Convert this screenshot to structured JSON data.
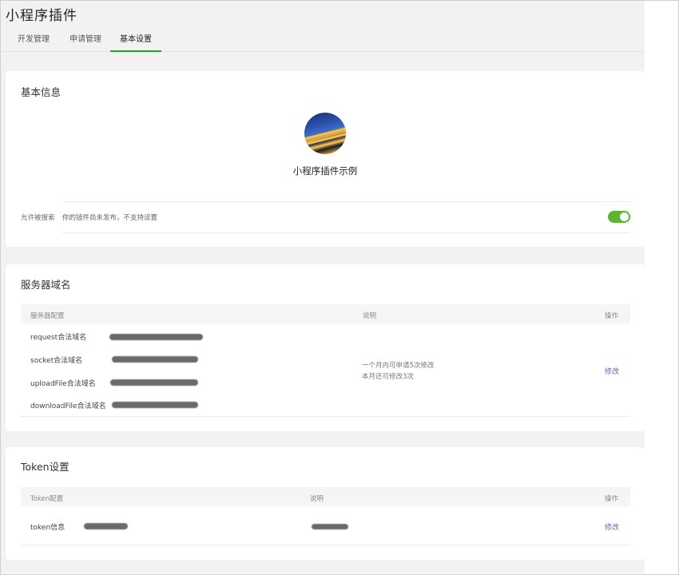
{
  "app": {
    "title": "小程序插件"
  },
  "tabs": [
    {
      "label": "开发管理",
      "active": false
    },
    {
      "label": "申请管理",
      "active": false
    },
    {
      "label": "基本设置",
      "active": true
    }
  ],
  "basic_info": {
    "title": "基本信息",
    "plugin_name": "小程序插件示例",
    "search": {
      "label": "允许被搜索",
      "description": "你的插件尚未发布，不支持设置",
      "toggle_on": true
    }
  },
  "server_domain": {
    "title": "服务器域名",
    "headers": {
      "config": "服务器配置",
      "note": "说明",
      "action": "操作"
    },
    "rows": [
      {
        "label": "request合法域名"
      },
      {
        "label": "socket合法域名"
      },
      {
        "label": "uploadFile合法域名"
      },
      {
        "label": "downloadFile合法域名"
      }
    ],
    "note_line1": "一个月内可申请5次修改",
    "note_line2": "本月还可修改3次",
    "action_label": "修改"
  },
  "token": {
    "title": "Token设置",
    "headers": {
      "config": "Token配置",
      "note": "说明",
      "action": "操作"
    },
    "row_label": "token信息",
    "action_label": "修改"
  },
  "colors": {
    "accent": "#1aad19",
    "toggle": "#5cb531",
    "link": "#5a6ca8"
  },
  "icons": {
    "avatar": "plugin-avatar-image"
  }
}
